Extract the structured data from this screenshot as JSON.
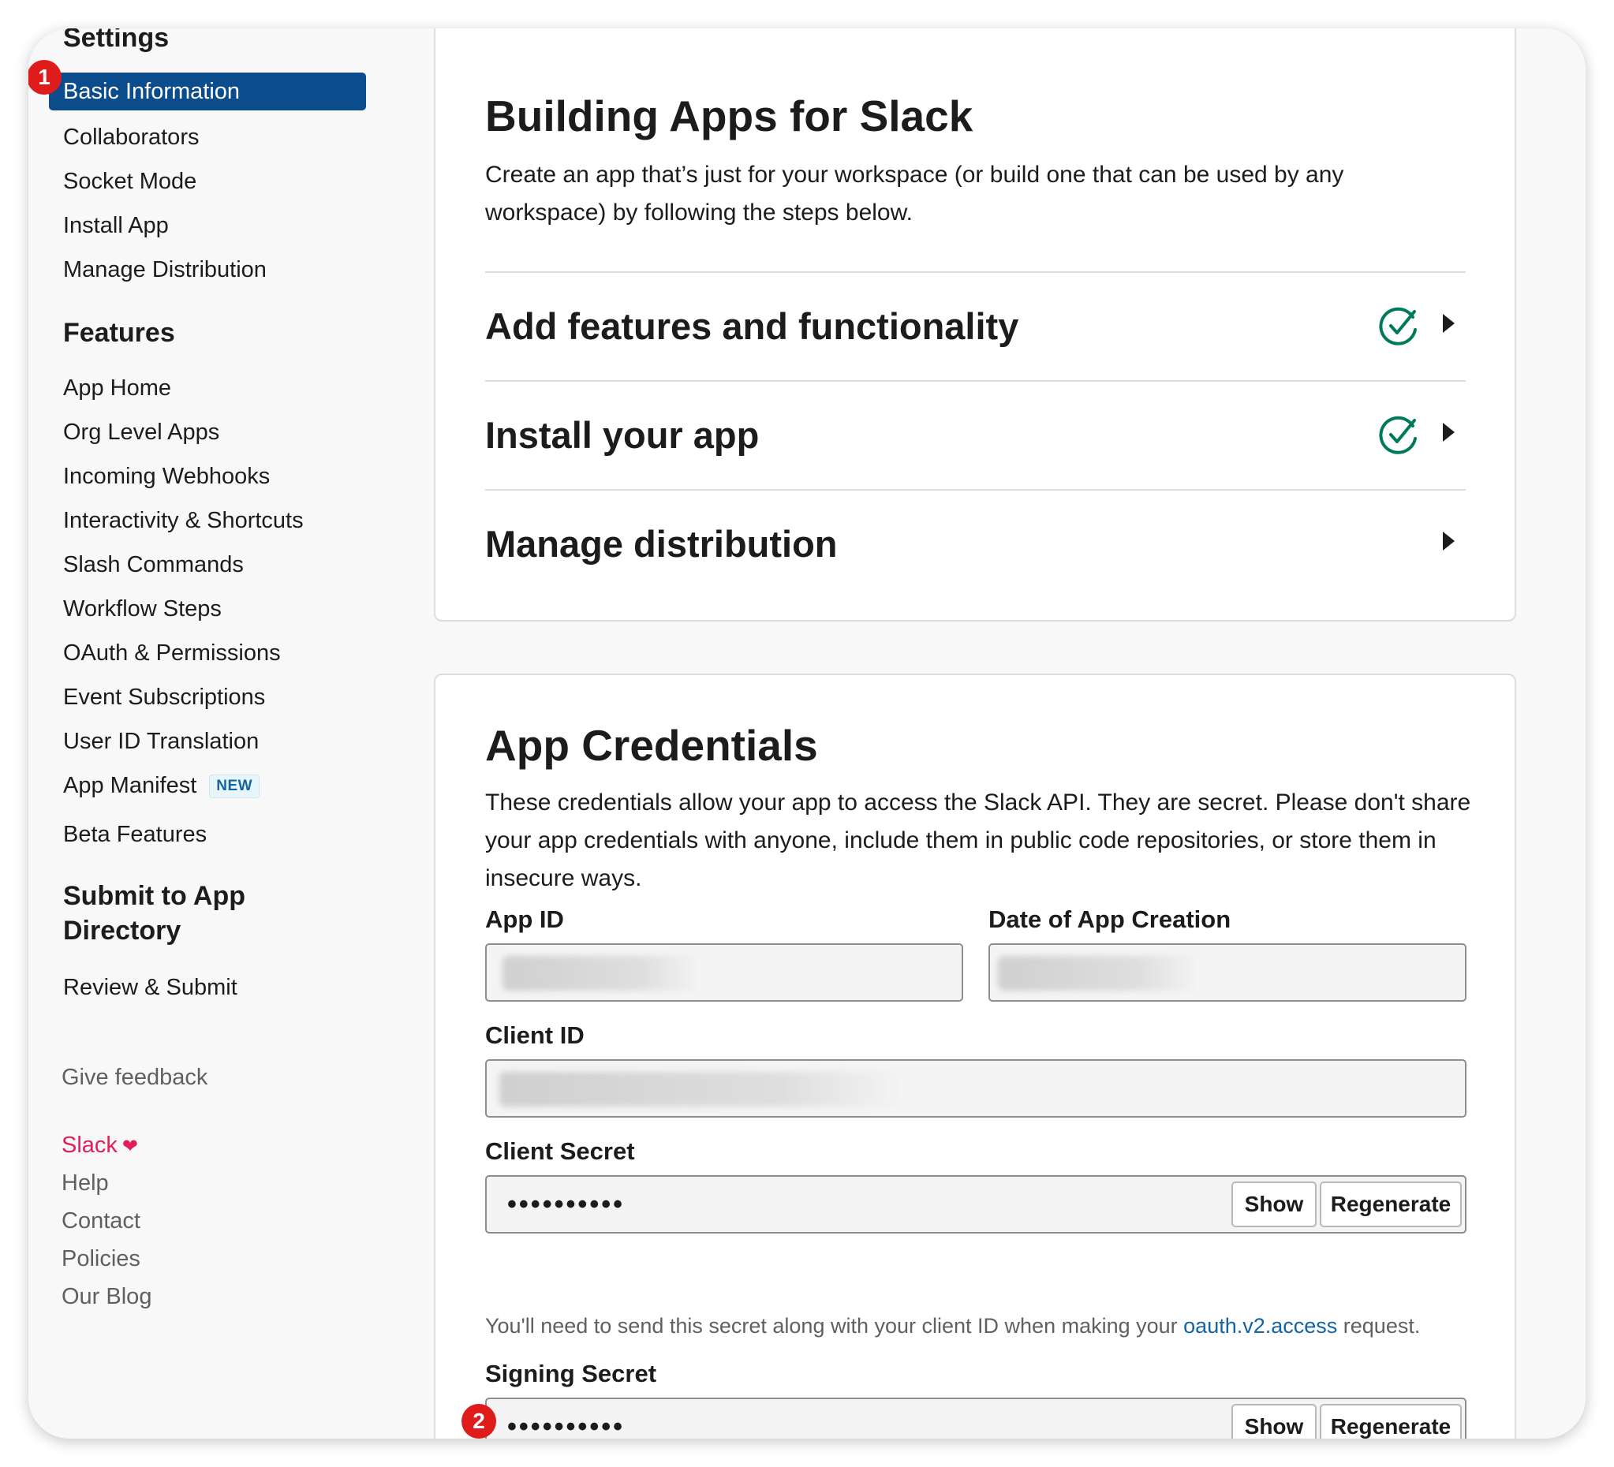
{
  "sidebar": {
    "settings_heading": "Settings",
    "settings_items": [
      {
        "label": "Basic Information",
        "active": true
      },
      {
        "label": "Collaborators"
      },
      {
        "label": "Socket Mode"
      },
      {
        "label": "Install App"
      },
      {
        "label": "Manage Distribution"
      }
    ],
    "features_heading": "Features",
    "features_items": [
      {
        "label": "App Home"
      },
      {
        "label": "Org Level Apps"
      },
      {
        "label": "Incoming Webhooks"
      },
      {
        "label": "Interactivity & Shortcuts"
      },
      {
        "label": "Slash Commands"
      },
      {
        "label": "Workflow Steps"
      },
      {
        "label": "OAuth & Permissions"
      },
      {
        "label": "Event Subscriptions"
      },
      {
        "label": "User ID Translation"
      },
      {
        "label": "App Manifest",
        "badge": "NEW"
      },
      {
        "label": "Beta Features"
      }
    ],
    "submit_heading_line1": "Submit to App",
    "submit_heading_line2": "Directory",
    "submit_items": [
      {
        "label": "Review & Submit"
      }
    ],
    "give_feedback": "Give feedback",
    "footer_links": [
      {
        "label": "Slack",
        "heart": true
      },
      {
        "label": "Help"
      },
      {
        "label": "Contact"
      },
      {
        "label": "Policies"
      },
      {
        "label": "Our Blog"
      }
    ]
  },
  "building": {
    "title": "Building Apps for Slack",
    "description": "Create an app that’s just for your workspace (or build one that can be used by any workspace) by following the steps below.",
    "steps": [
      {
        "label": "Add features and functionality",
        "completed": true
      },
      {
        "label": "Install your app",
        "completed": true
      },
      {
        "label": "Manage distribution",
        "completed": false
      }
    ]
  },
  "credentials": {
    "title": "App Credentials",
    "description": "These credentials allow your app to access the Slack API. They are secret. Please don't share your app credentials with anyone, include them in public code repositories, or store them in insecure ways.",
    "app_id_label": "App ID",
    "date_label": "Date of App Creation",
    "client_id_label": "Client ID",
    "client_secret_label": "Client Secret",
    "client_secret_value": "••••••••••",
    "client_secret_help_before": "You'll need to send this secret along with your client ID when making your ",
    "client_secret_help_link": "oauth.v2.access",
    "client_secret_help_after": " request.",
    "signing_secret_label": "Signing Secret",
    "signing_secret_value": "••••••••••",
    "show_label": "Show",
    "regenerate_label": "Regenerate"
  },
  "markers": [
    "1",
    "2"
  ],
  "colors": {
    "active_nav": "#0b4c8c",
    "check_green": "#007a5a",
    "marker_red": "#e01b1b",
    "slack_pink": "#e01e5a",
    "link_blue": "#1264a3"
  }
}
